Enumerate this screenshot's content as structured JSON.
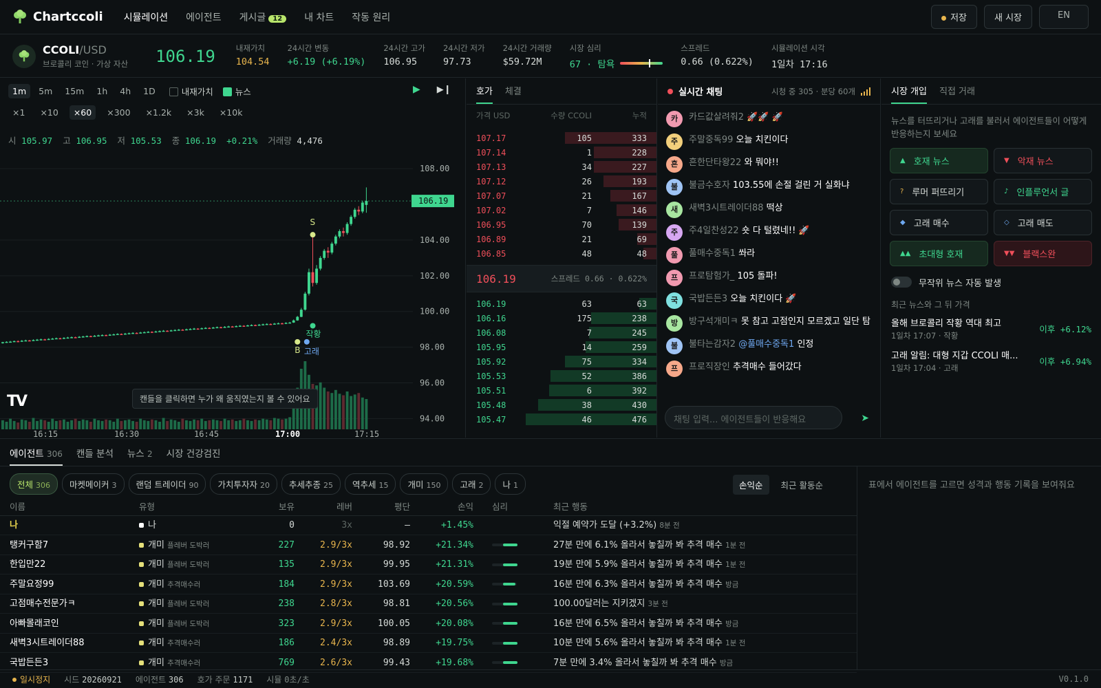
{
  "app": {
    "name": "Chartccoli"
  },
  "nav": [
    {
      "label": "시뮬레이션",
      "active": true
    },
    {
      "label": "에이전트"
    },
    {
      "label": "게시글",
      "badge": "12"
    },
    {
      "label": "내 차트"
    },
    {
      "label": "작동 원리"
    }
  ],
  "top_buttons": {
    "save": "저장",
    "new_market": "새 시장",
    "lang": "EN"
  },
  "coin": {
    "symbol": "CCOLI",
    "quote": "/USD",
    "subtitle": "브로콜리 코인 · 가상 자산",
    "price": "106.19"
  },
  "stats": [
    {
      "label": "내재가치",
      "value": "104.54",
      "color": "gold"
    },
    {
      "label": "24시간 변동",
      "value": "+6.19 (+6.19%)",
      "color": "green"
    },
    {
      "label": "24시간 고가",
      "value": "106.95"
    },
    {
      "label": "24시간 저가",
      "value": "97.73"
    },
    {
      "label": "24시간 거래량",
      "value": "$59.72M"
    },
    {
      "label": "시장 심리",
      "value": "67 · 탐욕",
      "color": "green",
      "gauge": 0.67
    },
    {
      "label": "스프레드",
      "value": "0.66 (0.622%)"
    },
    {
      "label": "시뮬레이션 시각",
      "value": "1일차 17:16"
    }
  ],
  "chart_controls": {
    "timeframes": [
      "1m",
      "5m",
      "15m",
      "1h",
      "4h",
      "1D"
    ],
    "active_timeframe": "1m",
    "toggles": [
      {
        "label": "내재가치",
        "checked": false
      },
      {
        "label": "뉴스",
        "checked": true
      }
    ],
    "speeds": [
      "×1",
      "×10",
      "×60",
      "×300",
      "×1.2k",
      "×3k",
      "×10k"
    ],
    "active_speed": "×60"
  },
  "ohlc": {
    "o_label": "시",
    "o": "105.97",
    "h_label": "고",
    "h": "106.95",
    "l_label": "저",
    "l": "105.53",
    "c_label": "종",
    "c": "106.19",
    "chg": "+0.21%",
    "vol_label": "거래량",
    "vol": "4,476"
  },
  "chart_data": {
    "type": "candlestick",
    "x_ticks": [
      "16:15",
      "16:30",
      "16:45",
      "17:00",
      "17:15"
    ],
    "y_ticks": [
      "108.00",
      "104.00",
      "102.00",
      "100.00",
      "98.00",
      "96.00",
      "94.00"
    ],
    "current_price": "106.19",
    "markers": [
      {
        "label": "S"
      },
      {
        "label": "B"
      },
      {
        "label": "고래"
      },
      {
        "label": "작황"
      }
    ],
    "hint": "캔들을 클릭하면 누가 왜 움직였는지 볼 수 있어요",
    "candles": [
      [
        98.26,
        98.28,
        98.2,
        98.3
      ],
      [
        98.28,
        98.3,
        98.24,
        98.33
      ],
      [
        98.3,
        98.31,
        98.26,
        98.35
      ],
      [
        98.31,
        98.34,
        98.29,
        98.37
      ],
      [
        98.34,
        98.33,
        98.28,
        98.38
      ],
      [
        98.33,
        98.36,
        98.31,
        98.4
      ],
      [
        98.36,
        98.38,
        98.34,
        98.42
      ],
      [
        98.38,
        98.37,
        98.33,
        98.41
      ],
      [
        98.37,
        98.4,
        98.35,
        98.44
      ],
      [
        98.4,
        98.42,
        98.38,
        98.46
      ],
      [
        98.42,
        98.44,
        98.4,
        98.48
      ],
      [
        98.44,
        98.43,
        98.39,
        98.47
      ],
      [
        98.43,
        98.46,
        98.41,
        98.5
      ],
      [
        98.46,
        98.48,
        98.44,
        98.52
      ],
      [
        98.48,
        98.5,
        98.46,
        98.54
      ],
      [
        98.5,
        98.49,
        98.45,
        98.53
      ],
      [
        98.49,
        98.52,
        98.47,
        98.56
      ],
      [
        98.52,
        98.54,
        98.5,
        98.58
      ],
      [
        98.54,
        98.56,
        98.52,
        98.6
      ],
      [
        98.56,
        98.55,
        98.51,
        98.59
      ],
      [
        98.55,
        98.58,
        98.53,
        98.62
      ],
      [
        98.58,
        98.6,
        98.56,
        98.64
      ],
      [
        98.6,
        98.62,
        98.58,
        98.66
      ],
      [
        98.62,
        98.61,
        98.57,
        98.65
      ],
      [
        98.61,
        98.64,
        98.59,
        98.68
      ],
      [
        98.64,
        98.66,
        98.62,
        98.7
      ],
      [
        98.66,
        98.68,
        98.64,
        98.72
      ],
      [
        98.68,
        98.67,
        98.63,
        98.71
      ],
      [
        98.67,
        98.7,
        98.65,
        98.74
      ],
      [
        98.7,
        98.72,
        98.68,
        98.76
      ],
      [
        98.72,
        98.74,
        98.7,
        98.78
      ],
      [
        98.74,
        98.73,
        98.69,
        98.77
      ],
      [
        98.73,
        98.76,
        98.71,
        98.8
      ],
      [
        98.76,
        98.78,
        98.74,
        98.82
      ],
      [
        98.78,
        98.8,
        98.76,
        98.84
      ],
      [
        98.8,
        98.79,
        98.75,
        98.83
      ],
      [
        98.79,
        98.82,
        98.77,
        98.86
      ],
      [
        98.82,
        98.84,
        98.8,
        98.88
      ],
      [
        98.84,
        98.86,
        98.82,
        98.9
      ],
      [
        98.86,
        98.85,
        98.81,
        98.89
      ],
      [
        98.85,
        98.88,
        98.83,
        98.92
      ],
      [
        98.88,
        98.9,
        98.86,
        98.94
      ],
      [
        98.9,
        98.92,
        98.88,
        98.96
      ],
      [
        98.92,
        98.91,
        98.87,
        98.95
      ],
      [
        98.91,
        98.94,
        98.89,
        98.98
      ],
      [
        98.94,
        98.96,
        98.92,
        99.0
      ],
      [
        98.96,
        98.98,
        98.94,
        99.02
      ],
      [
        98.98,
        98.97,
        98.93,
        99.01
      ],
      [
        98.97,
        99.0,
        98.95,
        99.04
      ],
      [
        99.0,
        99.02,
        98.98,
        99.06
      ],
      [
        99.02,
        99.04,
        99.0,
        99.08
      ],
      [
        99.04,
        99.03,
        98.99,
        99.07
      ],
      [
        99.03,
        99.06,
        99.01,
        99.1
      ],
      [
        99.06,
        99.08,
        99.04,
        99.12
      ],
      [
        99.08,
        99.07,
        99.03,
        99.11
      ],
      [
        99.07,
        99.1,
        99.05,
        99.14
      ],
      [
        99.1,
        99.12,
        99.08,
        99.16
      ],
      [
        99.12,
        99.11,
        99.07,
        99.15
      ],
      [
        99.11,
        99.14,
        99.09,
        99.18
      ],
      [
        99.14,
        99.16,
        99.12,
        99.2
      ],
      [
        99.16,
        99.15,
        99.11,
        99.19
      ],
      [
        99.15,
        99.18,
        99.13,
        99.22
      ],
      [
        99.18,
        99.2,
        99.16,
        99.24
      ],
      [
        99.2,
        99.19,
        99.15,
        99.23
      ],
      [
        99.19,
        99.22,
        99.17,
        99.26
      ],
      [
        99.22,
        99.24,
        99.2,
        99.28
      ],
      [
        99.24,
        99.23,
        99.19,
        99.27
      ],
      [
        99.23,
        99.26,
        99.21,
        99.3
      ],
      [
        99.26,
        99.28,
        99.24,
        99.32
      ],
      [
        99.28,
        99.3,
        99.26,
        99.34
      ],
      [
        99.3,
        99.29,
        99.25,
        99.33
      ],
      [
        99.29,
        99.32,
        99.27,
        99.36
      ],
      [
        99.32,
        99.34,
        99.3,
        99.38
      ],
      [
        99.34,
        99.33,
        99.29,
        99.37
      ],
      [
        99.33,
        99.36,
        99.31,
        99.4
      ],
      [
        99.36,
        99.38,
        99.34,
        99.42
      ],
      [
        99.38,
        99.5,
        99.36,
        99.55
      ],
      [
        99.5,
        99.7,
        99.48,
        99.75
      ],
      [
        99.7,
        100.1,
        99.68,
        100.2
      ],
      [
        100.1,
        101.0,
        100.05,
        101.1
      ],
      [
        101.0,
        102.2,
        100.9,
        102.4
      ],
      [
        102.2,
        101.6,
        101.4,
        104.2
      ],
      [
        101.6,
        102.4,
        101.5,
        102.6
      ],
      [
        102.4,
        103.0,
        102.3,
        103.1
      ],
      [
        103.0,
        103.4,
        102.9,
        103.5
      ],
      [
        103.4,
        103.3,
        103.0,
        103.6
      ],
      [
        103.3,
        103.8,
        103.2,
        103.9
      ],
      [
        103.8,
        104.2,
        103.7,
        104.3
      ],
      [
        104.2,
        104.5,
        104.1,
        104.6
      ],
      [
        104.5,
        104.4,
        104.2,
        104.7
      ],
      [
        104.4,
        104.9,
        104.3,
        105.0
      ],
      [
        104.9,
        105.3,
        104.8,
        105.4
      ],
      [
        105.3,
        105.7,
        105.2,
        105.8
      ],
      [
        105.7,
        105.6,
        105.4,
        105.9
      ],
      [
        105.6,
        106.1,
        105.5,
        106.2
      ],
      [
        105.97,
        106.19,
        105.53,
        106.95
      ]
    ],
    "volumes": [
      12,
      10,
      14,
      11,
      9,
      13,
      12,
      10,
      15,
      11,
      13,
      12,
      10,
      14,
      11,
      12,
      13,
      10,
      12,
      14,
      11,
      13,
      12,
      10,
      14,
      12,
      11,
      13,
      12,
      10,
      14,
      11,
      12,
      13,
      11,
      10,
      14,
      12,
      11,
      13,
      12,
      10,
      15,
      11,
      13,
      12,
      10,
      14,
      12,
      11,
      13,
      12,
      14,
      11,
      12,
      13,
      12,
      11,
      14,
      12,
      13,
      11,
      12,
      14,
      12,
      11,
      13,
      12,
      14,
      13,
      12,
      15,
      14,
      13,
      14,
      16,
      40,
      55,
      80,
      90,
      72,
      60,
      58,
      62,
      55,
      50,
      48,
      52,
      47,
      45,
      50,
      44,
      46,
      48,
      42,
      40
    ]
  },
  "orderbook": {
    "tabs": [
      "호가",
      "체결"
    ],
    "headers": [
      "가격 USD",
      "수량 CCOLI",
      "누적"
    ],
    "asks": [
      [
        "107.17",
        "105",
        "333"
      ],
      [
        "107.14",
        "1",
        "228"
      ],
      [
        "107.13",
        "34",
        "227"
      ],
      [
        "107.12",
        "26",
        "193"
      ],
      [
        "107.07",
        "21",
        "167"
      ],
      [
        "107.02",
        "7",
        "146"
      ],
      [
        "106.95",
        "70",
        "139"
      ],
      [
        "106.89",
        "21",
        "69"
      ],
      [
        "106.85",
        "48",
        "48"
      ]
    ],
    "mid_price": "106.19",
    "spread_label": "스프레드 0.66 · 0.622%",
    "bids": [
      [
        "106.19",
        "63",
        "63"
      ],
      [
        "106.16",
        "175",
        "238"
      ],
      [
        "106.08",
        "7",
        "245"
      ],
      [
        "105.95",
        "14",
        "259"
      ],
      [
        "105.92",
        "75",
        "334"
      ],
      [
        "105.53",
        "52",
        "386"
      ],
      [
        "105.51",
        "6",
        "392"
      ],
      [
        "105.48",
        "38",
        "430"
      ],
      [
        "105.47",
        "46",
        "476"
      ]
    ]
  },
  "chat": {
    "title": "실시간 채팅",
    "viewers": "시청 중 305 · 분당 60개",
    "messages": [
      {
        "avatar": "카",
        "color": "#f19ab0",
        "user": "카드값살려줘2",
        "text": "🚀🚀 🚀"
      },
      {
        "avatar": "주",
        "color": "#f2cf7c",
        "user": "주말중독99",
        "text": "오늘 치킨이다"
      },
      {
        "avatar": "흔",
        "color": "#f6a88a",
        "user": "흔한단타왕22",
        "text": "와 뭐야!!"
      },
      {
        "avatar": "불",
        "color": "#9fc4f5",
        "user": "불금수호자",
        "text": "103.55에 손절 걸린 거 실화냐"
      },
      {
        "avatar": "새",
        "color": "#a8e6a1",
        "user": "새벽3시트레이더88",
        "text": "떡상"
      },
      {
        "avatar": "주",
        "color": "#d7a7f2",
        "user": "주4일찬성22",
        "text": "숏 다 털렸네!! 🚀"
      },
      {
        "avatar": "풀",
        "color": "#f19ab0",
        "user": "풀매수중독1",
        "text": "쏴라"
      },
      {
        "avatar": "프",
        "color": "#f19ab0",
        "user": "프로탐험가_",
        "text": "105 돌파!"
      },
      {
        "avatar": "국",
        "color": "#7fe0e0",
        "user": "국밥든든3",
        "text": "오늘 치킨이다 🚀"
      },
      {
        "avatar": "방",
        "color": "#a8e6a1",
        "user": "방구석개미ㅋ",
        "text": "못 참고 고점인지 모르겠고 일단 탐"
      },
      {
        "avatar": "불",
        "color": "#9fc4f5",
        "user": "불타는감자2",
        "mention": "@풀매수중독1",
        "text": "인정"
      },
      {
        "avatar": "프",
        "color": "#f6a88a",
        "user": "프로직장인",
        "text": "추격매수 들어갔다"
      }
    ],
    "input_placeholder": "채팅 입력... 에이전트들이 반응해요"
  },
  "market": {
    "tabs": [
      "시장 개입",
      "직접 거래"
    ],
    "description": "뉴스를 터뜨리거나 고래를 불러서 에이전트들이 어떻게 반응하는지 보세요",
    "buttons": [
      {
        "icon": "▲",
        "label": "호재 뉴스",
        "style": "g"
      },
      {
        "icon": "▼",
        "label": "악재 뉴스",
        "style": "rt"
      },
      {
        "icon": "?",
        "label": "루머 퍼뜨리기",
        "style": "n",
        "iconColor": "#e8b54d"
      },
      {
        "icon": "♪",
        "label": "인플루언서 글",
        "style": "gt"
      },
      {
        "icon": "◆",
        "label": "고래 매수",
        "style": "n",
        "iconColor": "#6fa8f0"
      },
      {
        "icon": "◇",
        "label": "고래 매도",
        "style": "n",
        "iconColor": "#6fa8f0"
      },
      {
        "icon": "▲▲",
        "label": "초대형 호재",
        "style": "g"
      },
      {
        "icon": "▼▼",
        "label": "블랙스완",
        "style": "r"
      }
    ],
    "auto_news_label": "무작위 뉴스 자동 발생",
    "recent_title": "최근 뉴스와 그 뒤 가격",
    "news": [
      {
        "title": "올해 브로콜리 작황 역대 최고",
        "meta": "1일차 17:07 · 작황",
        "after": "이후 +6.12%"
      },
      {
        "title": "고래 알림: 대형 지갑 CCOLI 매...",
        "meta": "1일차 17:04 · 고래",
        "after": "이후 +6.94%"
      }
    ]
  },
  "bottom": {
    "tabs": [
      {
        "label": "에이전트",
        "count": "306"
      },
      {
        "label": "캔들 분석"
      },
      {
        "label": "뉴스",
        "count": "2"
      },
      {
        "label": "시장 건강검진"
      }
    ],
    "filters": [
      {
        "label": "전체",
        "count": "306"
      },
      {
        "label": "마켓메이커",
        "count": "3"
      },
      {
        "label": "랜덤 트레이더",
        "count": "90"
      },
      {
        "label": "가치투자자",
        "count": "20"
      },
      {
        "label": "추세추종",
        "count": "25"
      },
      {
        "label": "역추세",
        "count": "15"
      },
      {
        "label": "개미",
        "count": "150"
      },
      {
        "label": "고래",
        "count": "2"
      },
      {
        "label": "나",
        "count": "1"
      }
    ],
    "sort": [
      "손익순",
      "최근 활동순"
    ],
    "columns": [
      "이름",
      "유형",
      "보유",
      "레버",
      "평단",
      "손익",
      "심리",
      "최근 행동"
    ],
    "rows": [
      {
        "name": "나",
        "type": "나",
        "sub": "",
        "dot": "#ffffff",
        "hold": "0",
        "lev": "3x",
        "avg": "–",
        "pnl": "+1.45%",
        "sent": 0,
        "action": "익절 예약가 도달 (+3.2%)",
        "ago": "8분 전",
        "me": true
      },
      {
        "name": "탱커구함7",
        "type": "개미",
        "sub": "플레버 도박러",
        "dot": "#e5e07a",
        "hold": "227",
        "lev": "2.9/3x",
        "avg": "98.92",
        "pnl": "+21.34%",
        "sent": 0.7,
        "action": "27분 만에 6.1% 올라서 놓칠까 봐 추격 매수",
        "ago": "1분 전"
      },
      {
        "name": "한입만22",
        "type": "개미",
        "sub": "플레버 도박러",
        "dot": "#e5e07a",
        "hold": "135",
        "lev": "2.9/3x",
        "avg": "99.95",
        "pnl": "+21.31%",
        "sent": 0.7,
        "action": "19분 만에 5.9% 올라서 놓칠까 봐 추격 매수",
        "ago": "1분 전"
      },
      {
        "name": "주말요정99",
        "type": "개미",
        "sub": "추격매수러",
        "dot": "#e5e07a",
        "hold": "184",
        "lev": "2.9/3x",
        "avg": "103.69",
        "pnl": "+20.59%",
        "sent": 0.6,
        "action": "16분 만에 6.3% 올라서 놓칠까 봐 추격 매수",
        "ago": "방금"
      },
      {
        "name": "고점매수전문가ㅋ",
        "type": "개미",
        "sub": "플레버 도박러",
        "dot": "#e5e07a",
        "hold": "238",
        "lev": "2.8/3x",
        "avg": "98.81",
        "pnl": "+20.56%",
        "sent": 0.7,
        "action": "100.00달러는 지키겠지",
        "ago": "3분 전"
      },
      {
        "name": "아빠몰래코인",
        "type": "개미",
        "sub": "플레버 도박러",
        "dot": "#e5e07a",
        "hold": "323",
        "lev": "2.9/3x",
        "avg": "100.05",
        "pnl": "+20.08%",
        "sent": 0.7,
        "action": "16분 만에 6.5% 올라서 놓칠까 봐 추격 매수",
        "ago": "방금"
      },
      {
        "name": "새벽3시트레이더88",
        "type": "개미",
        "sub": "추격매수러",
        "dot": "#e5e07a",
        "hold": "186",
        "lev": "2.4/3x",
        "avg": "98.89",
        "pnl": "+19.75%",
        "sent": 0.7,
        "action": "10분 만에 5.6% 올라서 놓칠까 봐 추격 매수",
        "ago": "1분 전"
      },
      {
        "name": "국밥든든3",
        "type": "개미",
        "sub": "추격매수러",
        "dot": "#e5e07a",
        "hold": "769",
        "lev": "2.6/3x",
        "avg": "99.43",
        "pnl": "+19.68%",
        "sent": 0.7,
        "action": "7분 만에 3.4% 올라서 놓칠까 봐 추격 매수",
        "ago": "방금"
      }
    ],
    "detail_hint": "표에서 에이전트를 고르면 성격과 행동 기록을 보여줘요"
  },
  "status": {
    "state": "일시정지",
    "seed_label": "시드",
    "seed": "20260921",
    "agents_label": "에이전트",
    "agents": "306",
    "orders_label": "호가 주문",
    "orders": "1171",
    "rate_label": "시뮬",
    "rate": "0초/초",
    "version": "V0.1.0"
  }
}
